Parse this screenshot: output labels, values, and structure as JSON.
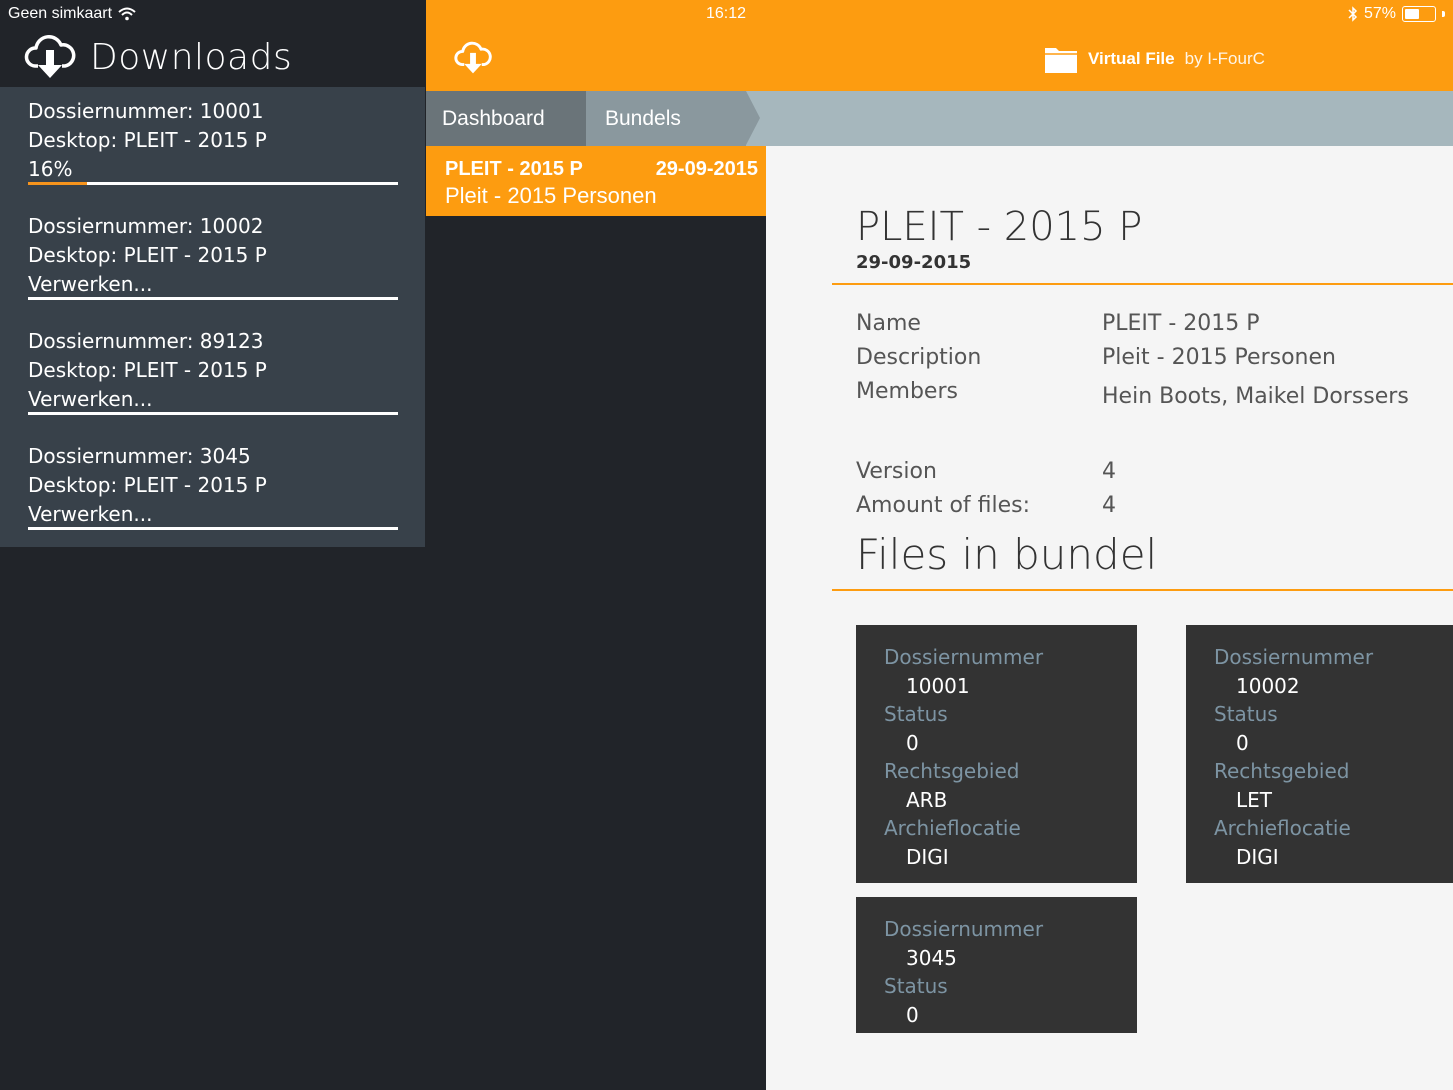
{
  "status": {
    "carrier": "Geen simkaart",
    "time": "16:12",
    "battery": "57%",
    "battery_fraction": 0.57
  },
  "downloads": {
    "title": "Downloads",
    "items": [
      {
        "dossier": "Dossiernummer: 10001",
        "desktop": "Desktop: PLEIT - 2015 P",
        "state": "16%",
        "progress": 0.16
      },
      {
        "dossier": "Dossiernummer: 10002",
        "desktop": "Desktop: PLEIT - 2015 P",
        "state": "Verwerken...",
        "progress": 0
      },
      {
        "dossier": "Dossiernummer: 89123",
        "desktop": "Desktop: PLEIT - 2015 P",
        "state": "Verwerken...",
        "progress": 0
      },
      {
        "dossier": "Dossiernummer: 3045",
        "desktop": "Desktop: PLEIT - 2015 P",
        "state": "Verwerken...",
        "progress": 0
      }
    ]
  },
  "brand": {
    "name": "Virtual File",
    "by": "by I-FourC"
  },
  "breadcrumb": {
    "dashboard": "Dashboard",
    "bundels": "Bundels"
  },
  "selected": {
    "title": "PLEIT - 2015 P",
    "date": "29-09-2015",
    "subtitle": "Pleit - 2015 Personen"
  },
  "detail": {
    "title": "PLEIT - 2015 P",
    "date": "29-09-2015",
    "name_label": "Name",
    "name_value": "PLEIT - 2015 P",
    "description_label": "Description",
    "description_value": "Pleit - 2015 Personen",
    "members_label": "Members",
    "members_value": "Hein Boots, Maikel Dorssers",
    "version_label": "Version",
    "version_value": "4",
    "files_label": "Amount of files:",
    "files_value": "4",
    "files_title": "Files in bundel"
  },
  "cards": [
    {
      "k1": "Dossiernummer",
      "v1": "10001",
      "k2": "Status",
      "v2": "0",
      "k3": "Rechtsgebied",
      "v3": "ARB",
      "k4": "Archieflocatie",
      "v4": "DIGI"
    },
    {
      "k1": "Dossiernummer",
      "v1": "10002",
      "k2": "Status",
      "v2": "0",
      "k3": "Rechtsgebied",
      "v3": "LET",
      "k4": "Archieflocatie",
      "v4": "DIGI"
    },
    {
      "k1": "Dossiernummer",
      "v1": "3045",
      "k2": "Status",
      "v2": "0"
    }
  ]
}
